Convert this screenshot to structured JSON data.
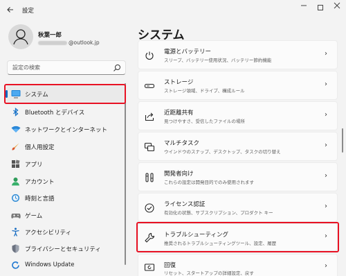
{
  "window": {
    "title": "設定",
    "back_icon": "back-arrow-icon",
    "controls": [
      "minimize-icon",
      "maximize-icon",
      "close-icon"
    ]
  },
  "user": {
    "name": "秋葉一郎",
    "email_suffix": "@outlook.jp"
  },
  "search": {
    "placeholder": "設定の検索"
  },
  "nav": {
    "active_index": 0,
    "accent_color": "#0067c0",
    "items": [
      {
        "label": "システム",
        "icon": "system-display-icon"
      },
      {
        "label": "Bluetooth とデバイス",
        "icon": "bluetooth-icon"
      },
      {
        "label": "ネットワークとインターネット",
        "icon": "network-wifi-icon"
      },
      {
        "label": "個人用設定",
        "icon": "paint-brush-icon"
      },
      {
        "label": "アプリ",
        "icon": "apps-icon"
      },
      {
        "label": "アカウント",
        "icon": "account-person-icon"
      },
      {
        "label": "時刻と言語",
        "icon": "time-language-icon"
      },
      {
        "label": "ゲーム",
        "icon": "game-controller-icon"
      },
      {
        "label": "アクセシビリティ",
        "icon": "accessibility-icon"
      },
      {
        "label": "プライバシーとセキュリティ",
        "icon": "shield-icon"
      },
      {
        "label": "Windows Update",
        "icon": "windows-update-icon"
      }
    ]
  },
  "main": {
    "title": "システム",
    "cards": [
      {
        "title": "電源とバッテリー",
        "subtitle": "スリープ、バッテリー使用状況、バッテリー節約機能",
        "icon": "power-icon"
      },
      {
        "title": "ストレージ",
        "subtitle": "ストレージ領域、ドライブ、構成ルール",
        "icon": "storage-drive-icon"
      },
      {
        "title": "近距離共有",
        "subtitle": "見つけやすさ、受信したファイルの場所",
        "icon": "share-icon"
      },
      {
        "title": "マルチタスク",
        "subtitle": "ウインドウのスナップ、デスクトップ、タスクの切り替え",
        "icon": "multitask-icon"
      },
      {
        "title": "開発者向け",
        "subtitle": "これらの設定は開発目的でのみ使用されます",
        "icon": "developer-tools-icon"
      },
      {
        "title": "ライセンス認証",
        "subtitle": "有効化の状態、サブスクリプション、プロダクト キー",
        "icon": "activation-check-icon"
      },
      {
        "title": "トラブルシューティング",
        "subtitle": "推奨されるトラブルシューティングツール、設定、履歴",
        "icon": "wrench-icon"
      },
      {
        "title": "回復",
        "subtitle": "リセット、スタートアップの詳細設定、戻す",
        "icon": "recovery-icon"
      }
    ]
  },
  "highlight_color": "#e81123"
}
